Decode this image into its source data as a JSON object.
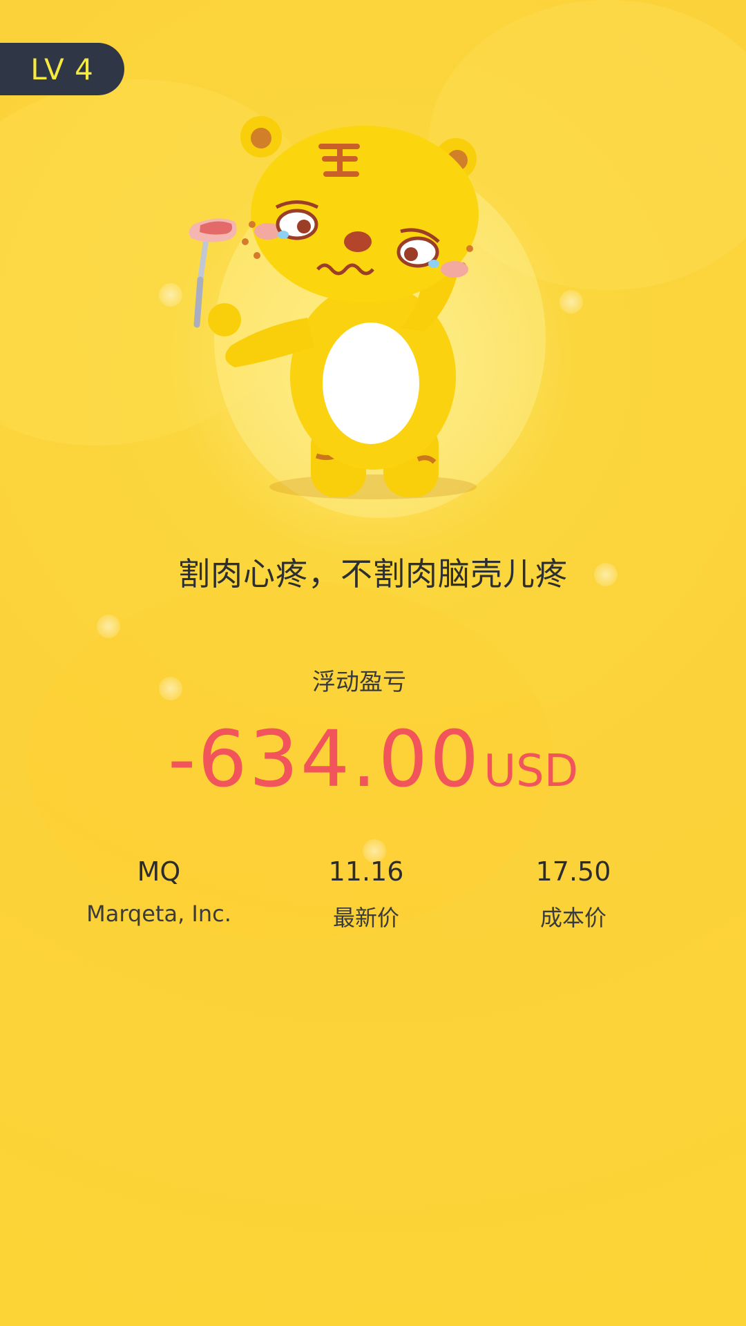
{
  "badge": {
    "level": "LV 4"
  },
  "message": "割肉心疼，不割肉脑壳儿疼",
  "pnl": {
    "label": "浮动盈亏",
    "amount": "-634.00",
    "currency": "USD"
  },
  "stats": {
    "symbol": "MQ",
    "company": "Marqeta, Inc.",
    "last_price_value": "11.16",
    "last_price_label": "最新价",
    "cost_price_value": "17.50",
    "cost_price_label": "成本价"
  },
  "colors": {
    "background": "#fcd23a",
    "badge_bg": "#2f3747",
    "badge_text": "#f6ea40",
    "loss_red": "#f2545b"
  },
  "icons": {
    "mascot": "sad-tiger-mascot"
  }
}
